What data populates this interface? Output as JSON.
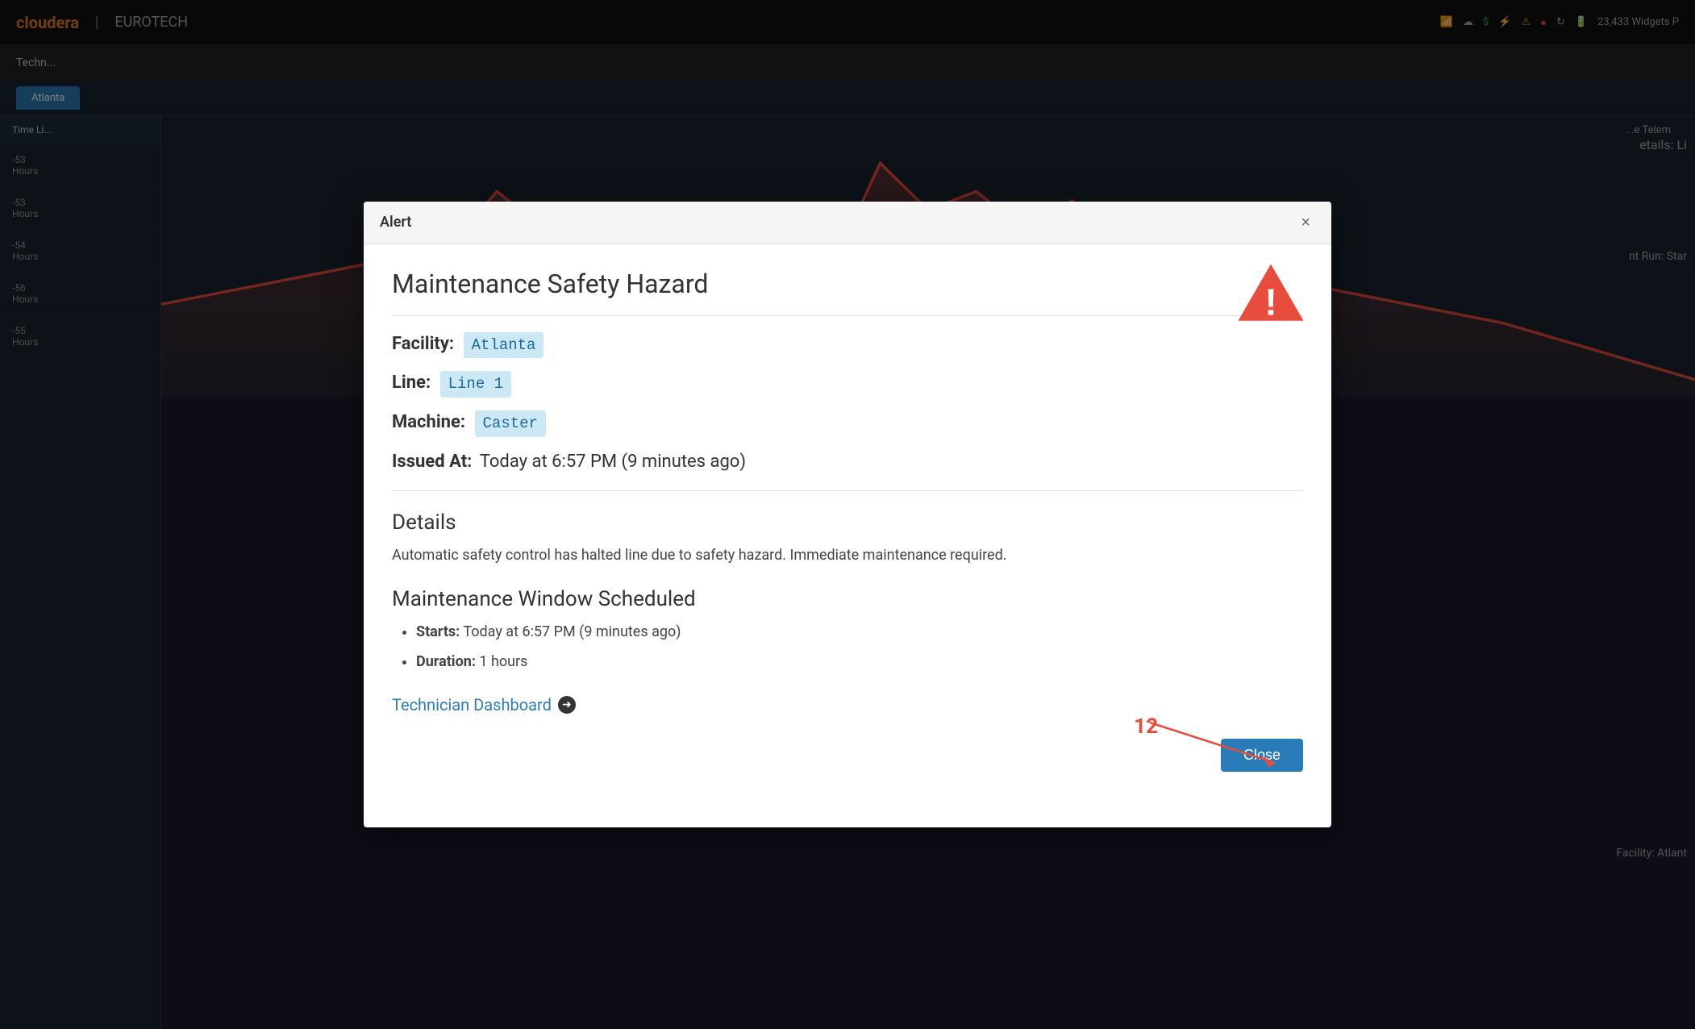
{
  "topbar": {
    "logo1": "cloudera",
    "logo2": "EUROTECH",
    "widgets_count": "23,433 Widgets P",
    "nav_title": "Techn..."
  },
  "tabs": [
    {
      "label": "Atlanta",
      "active": true
    }
  ],
  "table": {
    "header": "Time Li...",
    "rows": [
      {
        "time": "-53",
        "unit": "Hours"
      },
      {
        "time": "-53",
        "unit": "Hours"
      },
      {
        "time": "-54",
        "unit": "Hours"
      },
      {
        "time": "-56",
        "unit": "Hours"
      },
      {
        "time": "-55",
        "unit": "Hours"
      }
    ]
  },
  "chart": {
    "right_label": "...e Telem"
  },
  "background_text": {
    "details_label": "etails: Li",
    "current_run": "nt Run: Star",
    "facility": "Facility: Atlant"
  },
  "modal": {
    "header_title": "Alert",
    "close_x_label": "×",
    "alert_title": "Maintenance Safety Hazard",
    "facility_label": "Facility:",
    "facility_value": "Atlanta",
    "line_label": "Line:",
    "line_value": "Line 1",
    "machine_label": "Machine:",
    "machine_value": "Caster",
    "issued_at_label": "Issued At:",
    "issued_at_value": "Today at 6:57 PM (9 minutes ago)",
    "details_heading": "Details",
    "details_text": "Automatic safety control has halted line due to safety hazard. Immediate maintenance required.",
    "maintenance_heading": "Maintenance Window Scheduled",
    "starts_label": "Starts:",
    "starts_value": "Today at 6:57 PM (9 minutes ago)",
    "duration_label": "Duration:",
    "duration_value": "1 hours",
    "technician_link": "Technician Dashboard",
    "close_button_label": "Close",
    "annotation_number": "12"
  }
}
